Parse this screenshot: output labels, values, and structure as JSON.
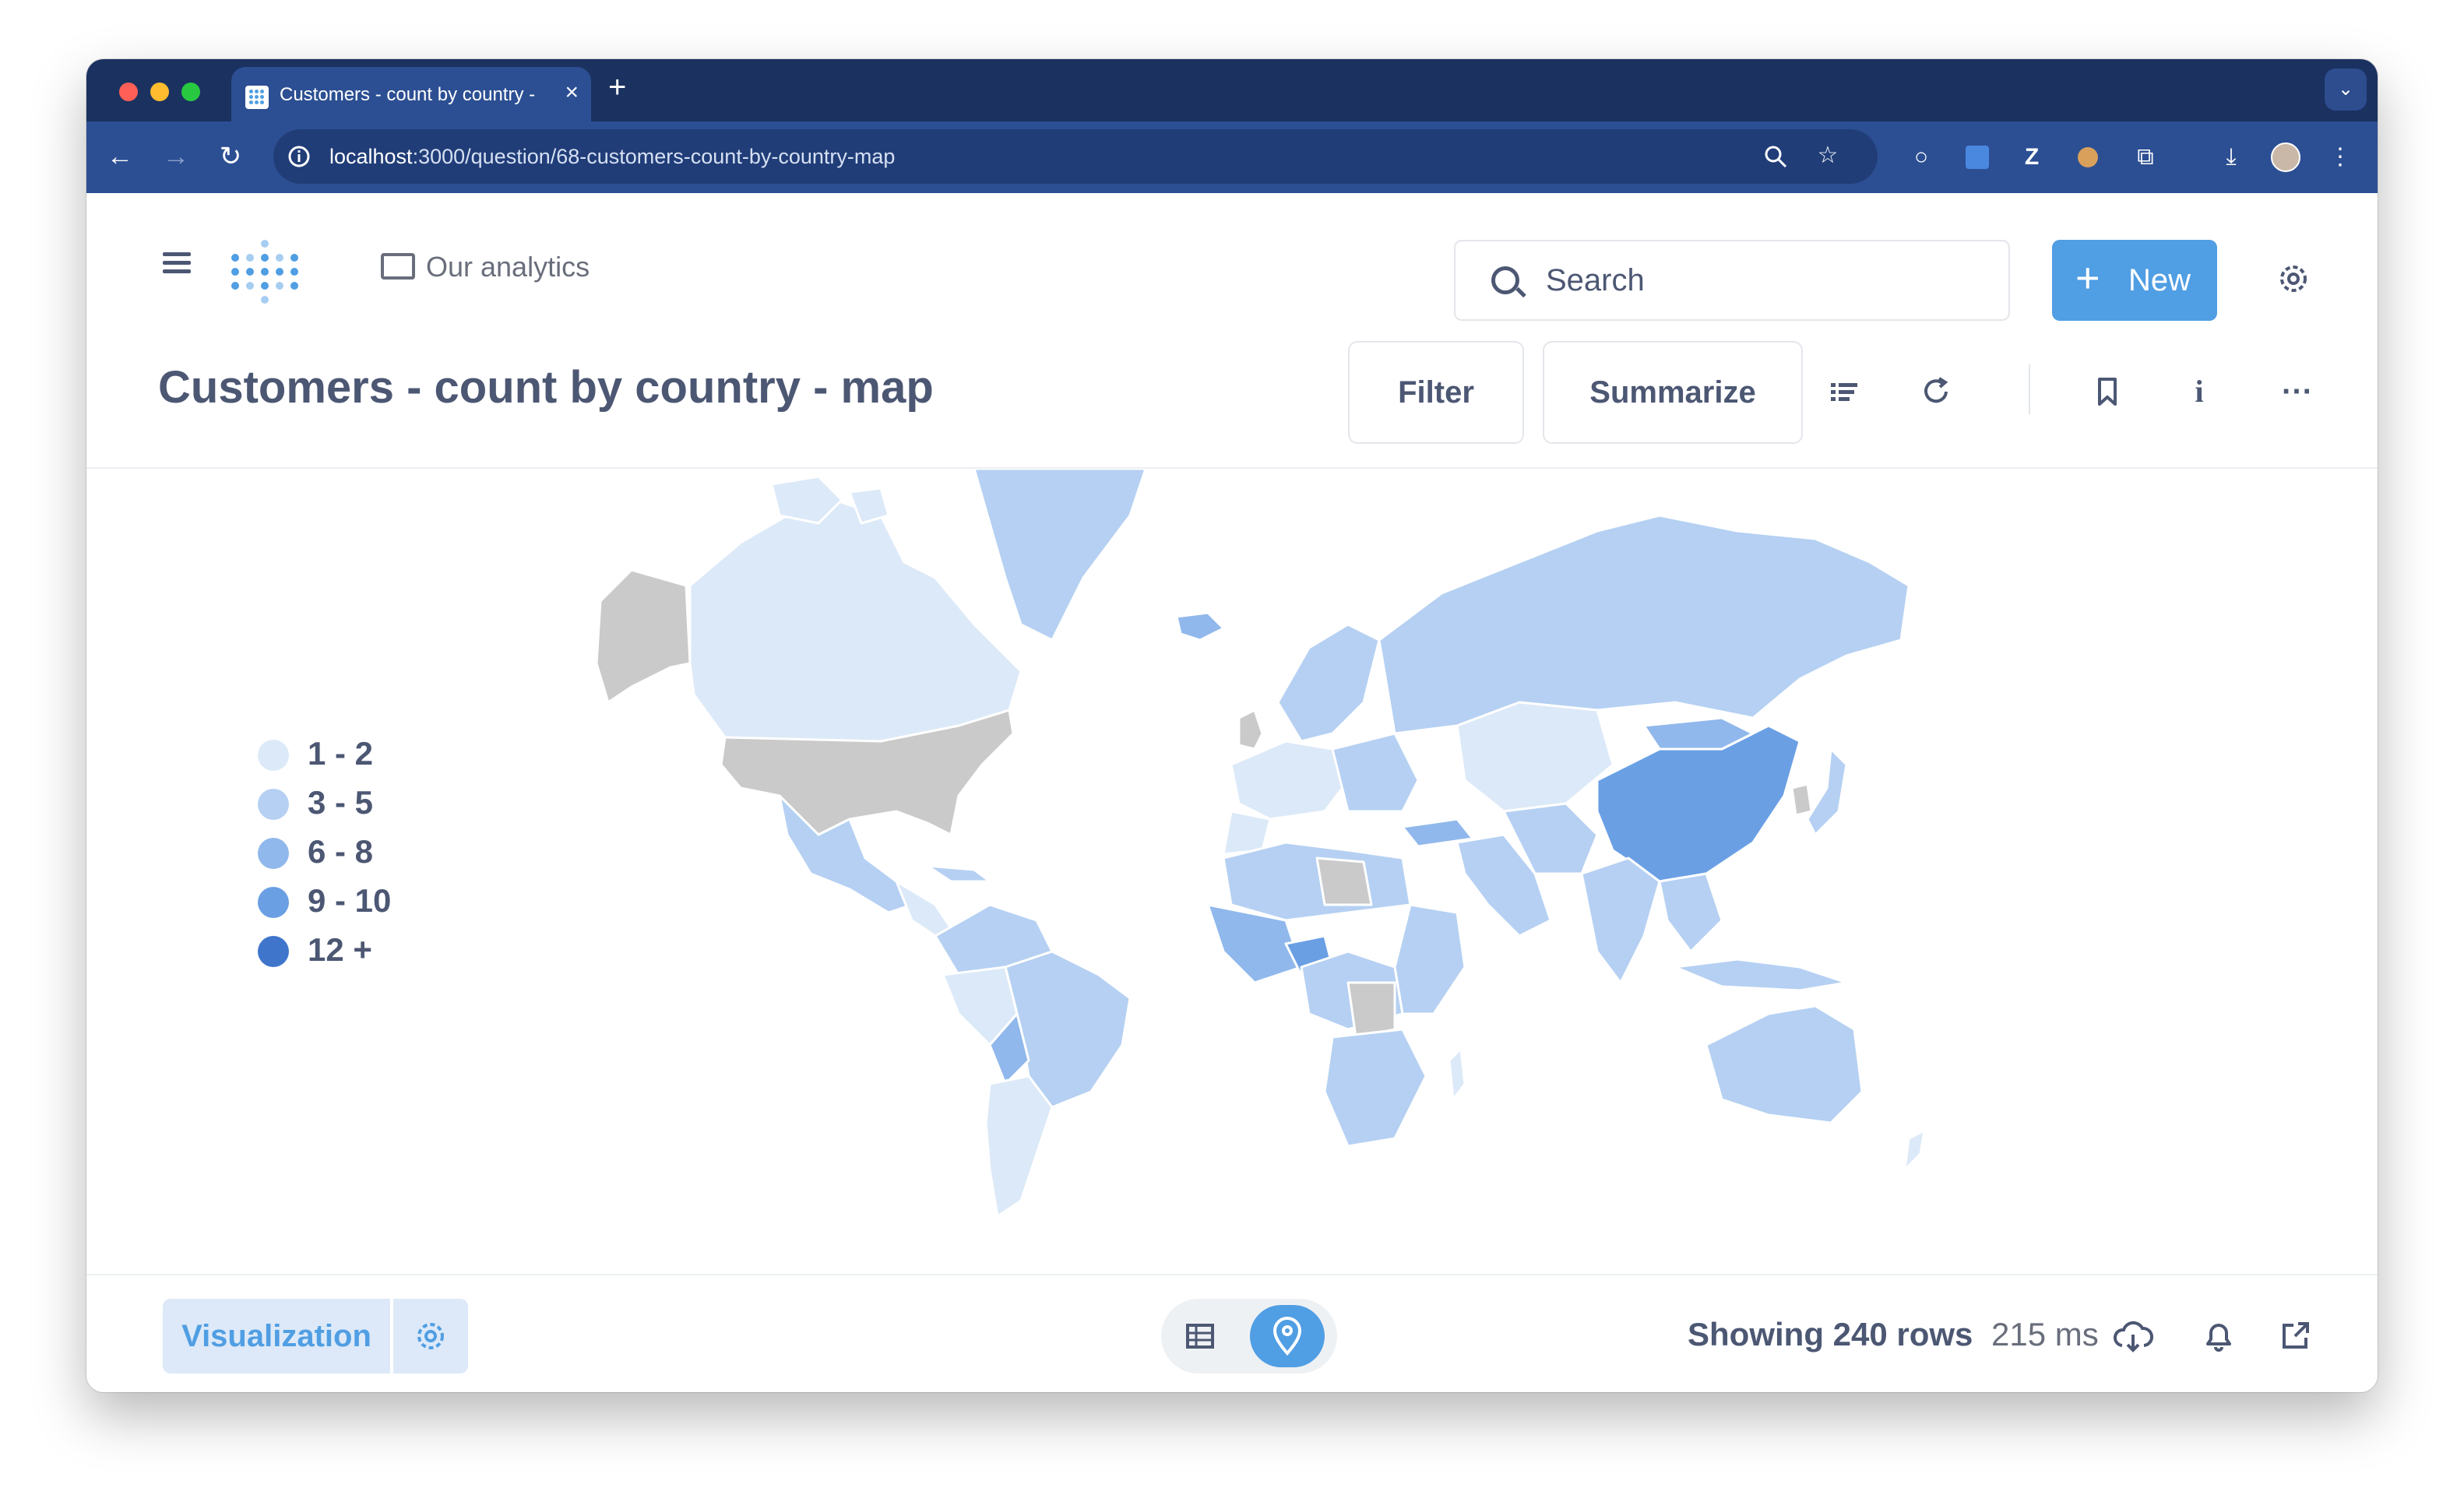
{
  "browser": {
    "tab_title": "Customers - count by country - map",
    "tab_close": "×",
    "new_tab": "+",
    "url_host": "localhost",
    "url_rest": ":3000/question/68-customers-count-by-country-map"
  },
  "header": {
    "collection": "Our analytics",
    "search_label": "Search",
    "new_label": "New",
    "new_plus": "+"
  },
  "question": {
    "title": "Customers - count by country - map",
    "filter_label": "Filter",
    "summarize_label": "Summarize",
    "info_glyph": "i",
    "more_glyph": "···"
  },
  "legend": [
    {
      "label": "1 - 2",
      "color": "#dce9f8"
    },
    {
      "label": "3 - 5",
      "color": "#b5d0f2"
    },
    {
      "label": "6 - 8",
      "color": "#90b8ec"
    },
    {
      "label": "9 - 10",
      "color": "#6a9fe4"
    },
    {
      "label": "12 +",
      "color": "#3f76cc"
    }
  ],
  "colors": {
    "brand": "#509ee3",
    "no_data": "#cacaca",
    "text": "#4c5773"
  },
  "footer": {
    "visualization_label": "Visualization",
    "row_count": "Showing 240 rows",
    "duration": "215 ms"
  }
}
